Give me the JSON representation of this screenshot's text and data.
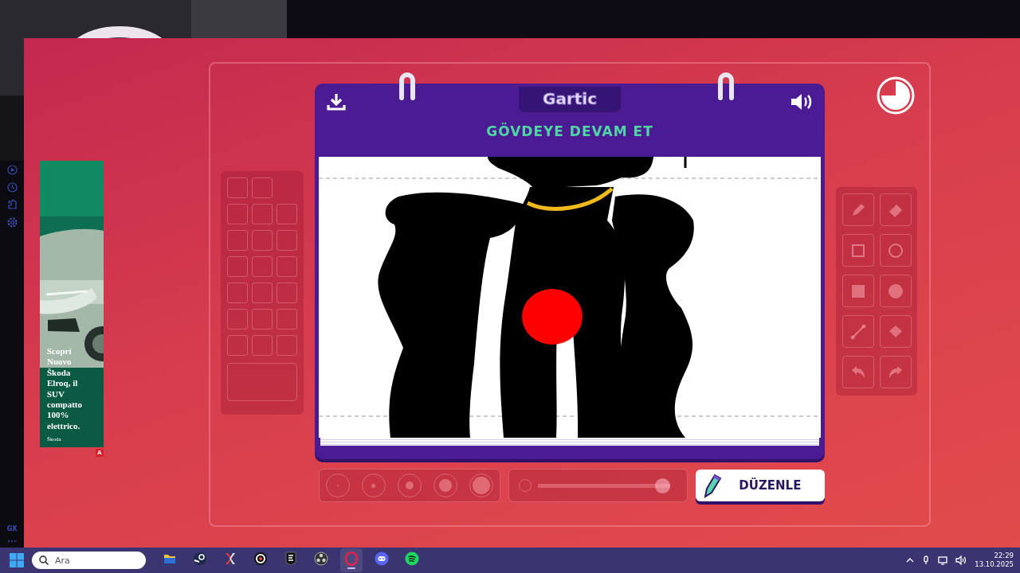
{
  "sidebar": {
    "badge": "GX"
  },
  "ad": {
    "text": "Scopri Nuovo Škoda Elroq, il SUV compatto 100% elettrico.",
    "advertiser": "Škoda",
    "marker": "A"
  },
  "game": {
    "logo": "Gartic",
    "prompt": "GÖVDEYE DEVAM ET",
    "action_button": "DÜZENLE",
    "opacity": {
      "level": 1
    },
    "brush_sizes": [
      {
        "selected": false
      },
      {
        "selected": false
      },
      {
        "selected": false
      },
      {
        "selected": false
      },
      {
        "selected": false
      }
    ]
  },
  "taskbar": {
    "search": {
      "placeholder": "Ara"
    },
    "time": "22:29",
    "date": "13.10.2025",
    "apps": [
      {
        "kind": "folder",
        "selected": false
      },
      {
        "kind": "steam",
        "selected": false
      },
      {
        "kind": "x",
        "selected": false
      },
      {
        "kind": "target",
        "selected": false
      },
      {
        "kind": "epic",
        "selected": false
      },
      {
        "kind": "obs",
        "selected": false
      },
      {
        "kind": "opera",
        "selected": true
      },
      {
        "kind": "discord",
        "selected": false
      },
      {
        "kind": "spotify",
        "selected": false
      }
    ]
  }
}
